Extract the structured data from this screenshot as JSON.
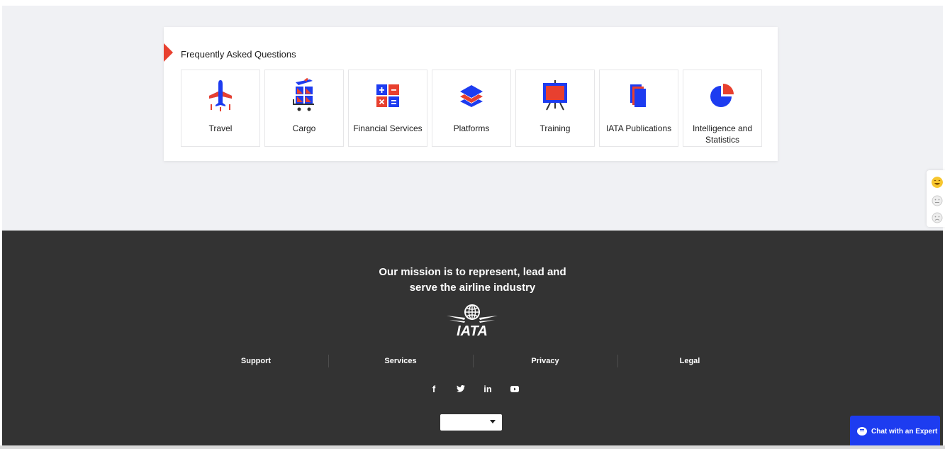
{
  "faq": {
    "title": "Frequently Asked Questions",
    "tiles": [
      {
        "label": "Travel",
        "icon": "plane-icon"
      },
      {
        "label": "Cargo",
        "icon": "cargo-cart-icon"
      },
      {
        "label": "Financial Services",
        "icon": "calculator-icon"
      },
      {
        "label": "Platforms",
        "icon": "layers-icon"
      },
      {
        "label": "Training",
        "icon": "presentation-board-icon"
      },
      {
        "label": "IATA Publications",
        "icon": "documents-icon"
      },
      {
        "label": "Intelligence and Statistics",
        "icon": "pie-chart-icon"
      }
    ]
  },
  "footer": {
    "mission_line1": "Our mission is to represent, lead and",
    "mission_line2": "serve the airline industry",
    "logo_text": "IATA",
    "links": [
      "Support",
      "Services",
      "Privacy",
      "Legal"
    ],
    "social": [
      {
        "glyph": "f",
        "icon": "facebook-icon"
      },
      {
        "glyph": "🐦",
        "icon": "twitter-icon"
      },
      {
        "glyph": "in",
        "icon": "linkedin-icon"
      },
      {
        "glyph": "▶",
        "icon": "youtube-icon"
      }
    ],
    "language_value": ""
  },
  "chat": {
    "label": "Chat with an Expert"
  },
  "colors": {
    "accent_red": "#e8402f",
    "accent_blue": "#1d3cf0",
    "footer_bg": "#333333",
    "page_bg": "#f0f1f4"
  }
}
